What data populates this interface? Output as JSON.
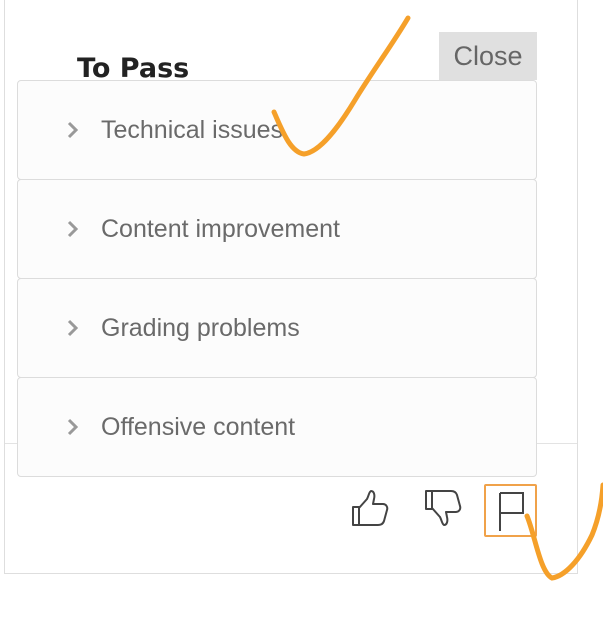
{
  "dialog": {
    "title": "To Pass",
    "close_label": "Close"
  },
  "menu": {
    "items": [
      {
        "label": "Technical issues",
        "icon": "chevron-right-icon"
      },
      {
        "label": "Content improvement",
        "icon": "chevron-right-icon"
      },
      {
        "label": "Grading problems",
        "icon": "chevron-right-icon"
      },
      {
        "label": "Offensive content",
        "icon": "chevron-right-icon"
      }
    ]
  },
  "actions": {
    "thumbs_up_icon": "thumbs-up-icon",
    "thumbs_down_icon": "thumbs-down-icon",
    "flag_icon": "flag-icon",
    "flag_active_border": "#f0a24a"
  },
  "annotation_color": "#f5a02a"
}
